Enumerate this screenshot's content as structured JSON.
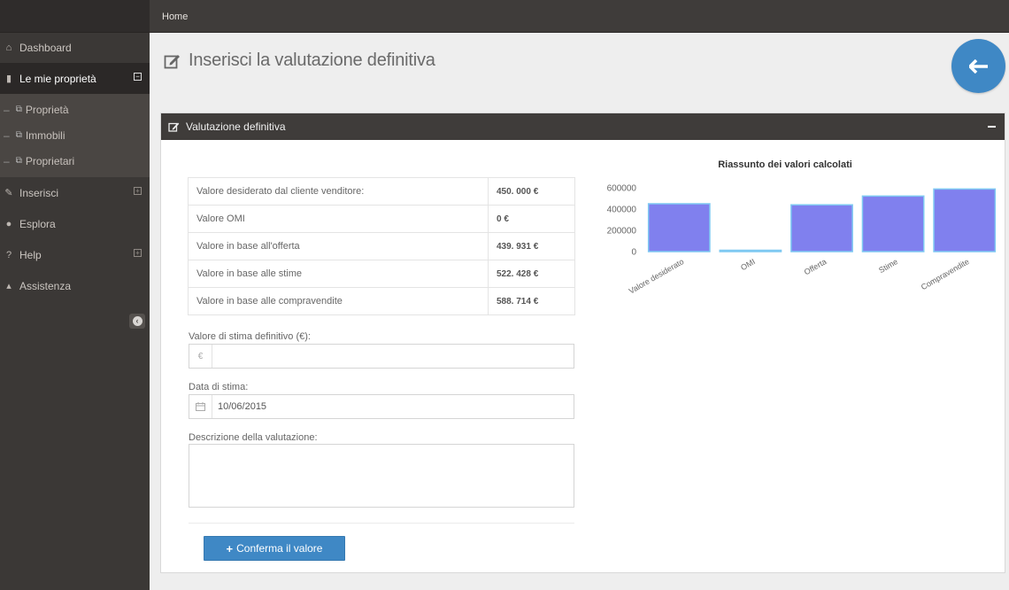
{
  "sidebar": {
    "items": [
      {
        "label": "Dashboard",
        "icon": "home-icon"
      },
      {
        "label": "Le mie proprietà",
        "icon": "building-icon",
        "toggle": "⊟"
      },
      {
        "label": "Inserisci",
        "icon": "pencil-icon",
        "toggle": "⊞"
      },
      {
        "label": "Esplora",
        "icon": "compass-icon"
      },
      {
        "label": "Help",
        "icon": "help-icon",
        "toggle": "⊞"
      },
      {
        "label": "Assistenza",
        "icon": "user-icon"
      }
    ],
    "subitems": [
      {
        "label": "Proprietà"
      },
      {
        "label": "Immobili"
      },
      {
        "label": "Proprietari"
      }
    ]
  },
  "topbar": {
    "breadcrumb": "Home"
  },
  "page": {
    "title": "Inserisci la valutazione definitiva"
  },
  "panel": {
    "title": "Valutazione definitiva",
    "table": [
      {
        "label": "Valore desiderato dal cliente venditore:",
        "value": "450. 000 €"
      },
      {
        "label": "Valore OMI",
        "value": "0 €"
      },
      {
        "label": "Valore in base all'offerta",
        "value": "439. 931 €"
      },
      {
        "label": "Valore in base alle stime",
        "value": "522. 428 €"
      },
      {
        "label": "Valore in base alle compravendite",
        "value": "588. 714 €"
      }
    ],
    "form": {
      "stima_label": "Valore di stima definitivo (€):",
      "stima_addon": "€",
      "stima_value": "",
      "data_label": "Data di stima:",
      "data_value": "10/06/2015",
      "descr_label": "Descrizione della valutazione:",
      "descr_value": ""
    },
    "confirm_label": "Conferma il valore"
  },
  "chart_data": {
    "type": "bar",
    "title": "Riassunto dei valori calcolati",
    "categories": [
      "Valore desiderato",
      "OMI",
      "Offerta",
      "Stime",
      "Compravendite"
    ],
    "values": [
      450000,
      0,
      439931,
      522428,
      588714
    ],
    "yticks": [
      "600000",
      "400000",
      "200000",
      "0"
    ],
    "ylim": [
      0,
      600000
    ],
    "xlabel": "",
    "ylabel": "",
    "bar_color": "#8080ee",
    "bar_border": "#7fc9f2",
    "legend": "none"
  }
}
